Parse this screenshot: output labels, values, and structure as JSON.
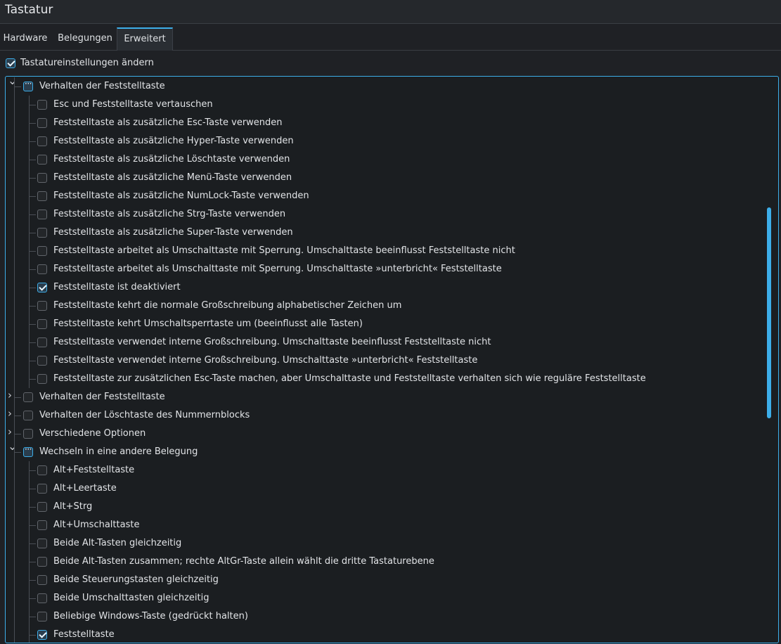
{
  "window": {
    "title": "Tastatur"
  },
  "tabs": [
    {
      "label": "Hardware"
    },
    {
      "label": "Belegungen"
    },
    {
      "label": "Erweitert"
    }
  ],
  "settings_toggle": {
    "label": "Tastatureinstellungen ändern",
    "checked": true
  },
  "tree": {
    "rows": [
      {
        "label": "Verhalten der Feststelltaste",
        "state": "partial",
        "level": 0,
        "expander": "open"
      },
      {
        "label": "Esc und Feststelltaste vertauschen",
        "state": "unchecked",
        "level": 1
      },
      {
        "label": "Feststelltaste als zusätzliche Esc-Taste verwenden",
        "state": "unchecked",
        "level": 1
      },
      {
        "label": "Feststelltaste als zusätzliche Hyper-Taste verwenden",
        "state": "unchecked",
        "level": 1
      },
      {
        "label": "Feststelltaste als zusätzliche Löschtaste verwenden",
        "state": "unchecked",
        "level": 1
      },
      {
        "label": "Feststelltaste als zusätzliche Menü-Taste verwenden",
        "state": "unchecked",
        "level": 1
      },
      {
        "label": "Feststelltaste als zusätzliche NumLock-Taste verwenden",
        "state": "unchecked",
        "level": 1
      },
      {
        "label": "Feststelltaste als zusätzliche Strg-Taste verwenden",
        "state": "unchecked",
        "level": 1
      },
      {
        "label": "Feststelltaste als zusätzliche Super-Taste verwenden",
        "state": "unchecked",
        "level": 1
      },
      {
        "label": "Feststelltaste arbeitet als Umschalttaste mit Sperrung. Umschalttaste beeinflusst Feststelltaste nicht",
        "state": "unchecked",
        "level": 1
      },
      {
        "label": "Feststelltaste arbeitet als Umschalttaste mit Sperrung. Umschalttaste »unterbricht« Feststelltaste",
        "state": "unchecked",
        "level": 1
      },
      {
        "label": "Feststelltaste ist deaktiviert",
        "state": "checked",
        "level": 1
      },
      {
        "label": "Feststelltaste kehrt die normale Großschreibung alphabetischer Zeichen um",
        "state": "unchecked",
        "level": 1
      },
      {
        "label": "Feststelltaste kehrt Umschaltsperrtaste um (beeinflusst alle Tasten)",
        "state": "unchecked",
        "level": 1
      },
      {
        "label": "Feststelltaste verwendet interne Großschreibung. Umschalttaste beeinflusst Feststelltaste nicht",
        "state": "unchecked",
        "level": 1
      },
      {
        "label": "Feststelltaste verwendet interne Großschreibung. Umschalttaste »unterbricht« Feststelltaste",
        "state": "unchecked",
        "level": 1
      },
      {
        "label": "Feststelltaste zur zusätzlichen Esc-Taste machen, aber Umschalttaste und Feststelltaste verhalten sich wie reguläre Feststelltaste",
        "state": "unchecked",
        "level": 1
      },
      {
        "label": "Verhalten der Feststelltaste",
        "state": "unchecked",
        "level": 0,
        "expander": "closed"
      },
      {
        "label": "Verhalten der Löschtaste des Nummernblocks",
        "state": "unchecked",
        "level": 0,
        "expander": "closed"
      },
      {
        "label": "Verschiedene Optionen",
        "state": "unchecked",
        "level": 0,
        "expander": "closed"
      },
      {
        "label": "Wechseln in eine andere Belegung",
        "state": "partial",
        "level": 0,
        "expander": "open"
      },
      {
        "label": "Alt+Feststelltaste",
        "state": "unchecked",
        "level": 1
      },
      {
        "label": "Alt+Leertaste",
        "state": "unchecked",
        "level": 1
      },
      {
        "label": "Alt+Strg",
        "state": "unchecked",
        "level": 1
      },
      {
        "label": "Alt+Umschalttaste",
        "state": "unchecked",
        "level": 1
      },
      {
        "label": "Beide Alt-Tasten gleichzeitig",
        "state": "unchecked",
        "level": 1
      },
      {
        "label": "Beide Alt-Tasten zusammen; rechte AltGr-Taste allein wählt die dritte Tastaturebene",
        "state": "unchecked",
        "level": 1
      },
      {
        "label": "Beide Steuerungstasten gleichzeitig",
        "state": "unchecked",
        "level": 1
      },
      {
        "label": "Beide Umschalttasten gleichzeitig",
        "state": "unchecked",
        "level": 1
      },
      {
        "label": "Beliebige Windows-Taste (gedrückt halten)",
        "state": "unchecked",
        "level": 1
      },
      {
        "label": "Feststelltaste",
        "state": "checked",
        "level": 1
      }
    ]
  },
  "colors": {
    "accent": "#3daee9",
    "background": "#1f2125"
  }
}
